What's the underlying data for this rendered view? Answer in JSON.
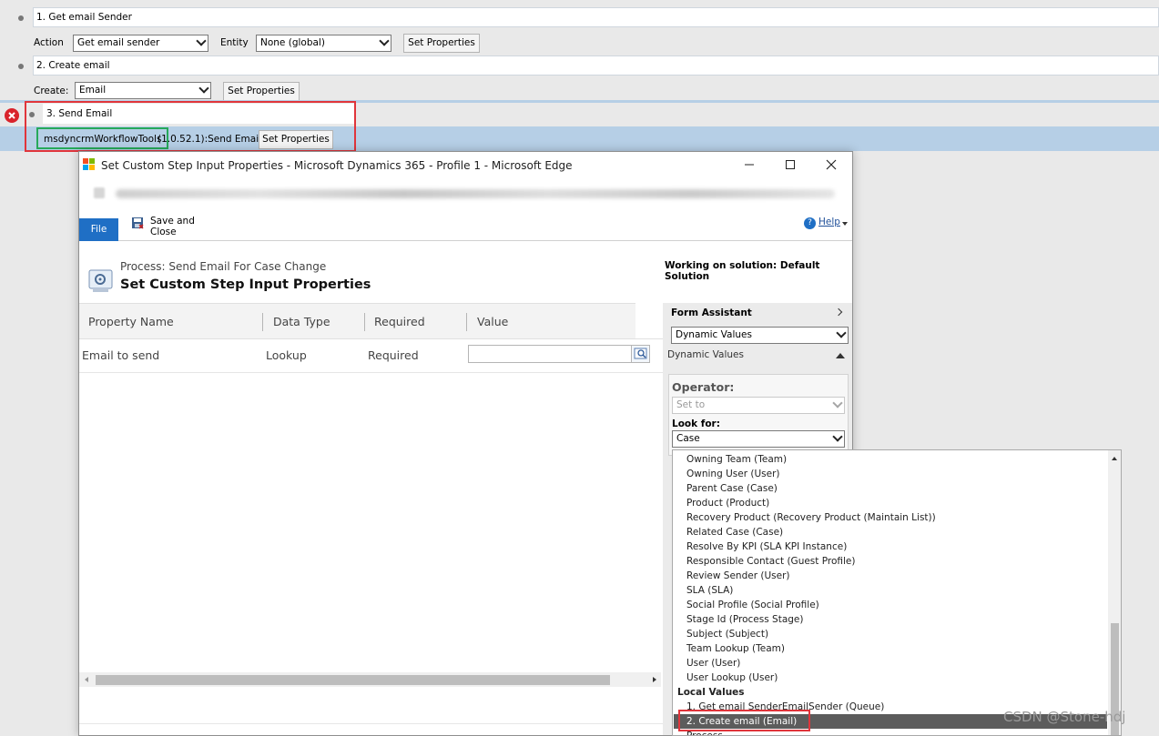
{
  "steps": {
    "step1": {
      "title": "1. Get email Sender",
      "action_label": "Action",
      "action_value": "Get email sender",
      "entity_label": "Entity",
      "entity_value": "None (global)",
      "set_properties": "Set Properties"
    },
    "step2": {
      "title": "2. Create email",
      "create_label": "Create:",
      "create_value": "Email",
      "set_properties": "Set Properties"
    },
    "step3": {
      "title": "3. Send Email",
      "tool": "msdyncrmWorkflowTools",
      "tool_suffix": "(1.0.52.1):Send Email",
      "set_properties": "Set Properties"
    }
  },
  "dialog": {
    "window_title": "Set Custom Step Input Properties - Microsoft Dynamics 365 - Profile 1 - Microsoft Edge",
    "ribbon": {
      "file_tab": "File",
      "save_close": "Save and Close",
      "help": "Help"
    },
    "process_label": "Process: Send Email For Case Change",
    "page_title": "Set Custom Step Input Properties",
    "solution": "Working on solution: Default Solution",
    "grid": {
      "headers": [
        "Property Name",
        "Data Type",
        "Required",
        "Value"
      ],
      "row": {
        "property": "Email to send",
        "type": "Lookup",
        "required": "Required",
        "value": ""
      }
    }
  },
  "form_assistant": {
    "title": "Form Assistant",
    "dropdown_value": "Dynamic Values",
    "section_label": "Dynamic Values",
    "operator_label": "Operator:",
    "operator_value": "Set to",
    "look_for_label": "Look for:",
    "look_for_value": "Case"
  },
  "lookup_list": {
    "items": [
      "Owning Team (Team)",
      "Owning User (User)",
      "Parent Case (Case)",
      "Product (Product)",
      "Recovery Product (Recovery Product (Maintain List))",
      "Related Case (Case)",
      "Resolve By KPI (SLA KPI Instance)",
      "Responsible Contact (Guest Profile)",
      "Review Sender (User)",
      "SLA (SLA)",
      "Social Profile (Social Profile)",
      "Stage Id (Process Stage)",
      "Subject (Subject)",
      "Team Lookup (Team)",
      "User (User)",
      "User Lookup (User)"
    ],
    "local_values_header": "Local Values",
    "local_items": [
      "1. Get email SenderEmailSender (Queue)",
      "2. Create email (Email)",
      "Process"
    ],
    "selected_index": 1
  },
  "watermark": "CSDN @Stone-hdj",
  "colors": {
    "accent": "#1f6fc5",
    "selection": "#b6cfe6",
    "highlight_red": "#e0353b",
    "highlight_green": "#27a95b",
    "list_selected": "#5c5c5c"
  }
}
